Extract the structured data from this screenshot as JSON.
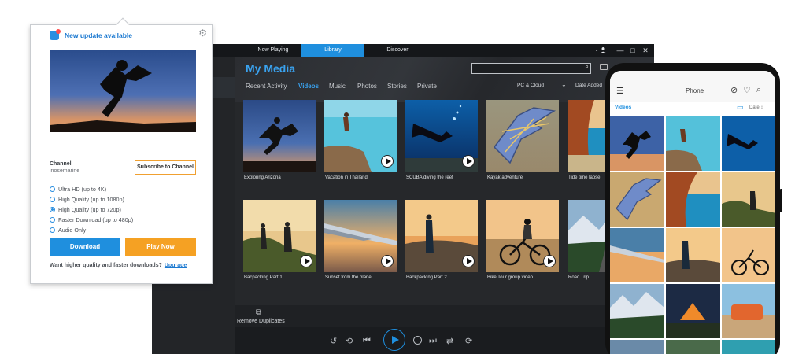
{
  "player": {
    "tabs": [
      "Now Playing",
      "Library",
      "Discover"
    ],
    "window_controls": [
      "⌄",
      "—",
      "□",
      "✕"
    ],
    "title": "My Media",
    "search": {
      "value": "",
      "icon": "search-icon"
    },
    "nav": [
      "Recent Activity",
      "Videos",
      "Music",
      "Photos",
      "Stories",
      "Private"
    ],
    "active_nav": "Videos",
    "source_filter": "PC & Cloud",
    "sort": "Date Added",
    "tiles": [
      {
        "label": "Exploring Arizona",
        "play": false
      },
      {
        "label": "Vacation in Thailand",
        "play": true
      },
      {
        "label": "SCUBA diving the reef",
        "play": true
      },
      {
        "label": "Kayak adventure",
        "play": false
      },
      {
        "label": "Tide time lapse",
        "play": false
      },
      {
        "label": "Bacpacking Part 1",
        "play": true
      },
      {
        "label": "Sunset from the plane",
        "play": true
      },
      {
        "label": "Backpacking Part 2",
        "play": true
      },
      {
        "label": "Bike Tour group video",
        "play": true
      },
      {
        "label": "Road Trip",
        "play": false
      }
    ],
    "remove_duplicates": "Remove Duplicates",
    "controls": [
      "↺",
      "⟲",
      "⏮",
      "⏭",
      "⇄",
      "⟳"
    ]
  },
  "popup": {
    "update_link": "New update available",
    "channel_label": "Channel",
    "channel_name": "inosemarine",
    "subscribe": "Subscribe to Channel",
    "options": [
      {
        "label": "Ultra HD (up to 4K)",
        "selected": false
      },
      {
        "label": "High Quality (up to 1080p)",
        "selected": false
      },
      {
        "label": "High Quality (up to 720p)",
        "selected": true
      },
      {
        "label": "Faster Download (up to 480p)",
        "selected": false
      },
      {
        "label": "Audio Only",
        "selected": false
      }
    ],
    "download": "Download",
    "play_now": "Play Now",
    "footer_text": "Want higher quality and faster downloads?",
    "footer_link": "Upgrade"
  },
  "phone": {
    "title": "Phone",
    "section": "Videos",
    "sort": "Date ↕"
  },
  "colors": {
    "accent_blue": "#1f8fde",
    "accent_orange": "#f5a123",
    "player_bg": "#26282b"
  }
}
